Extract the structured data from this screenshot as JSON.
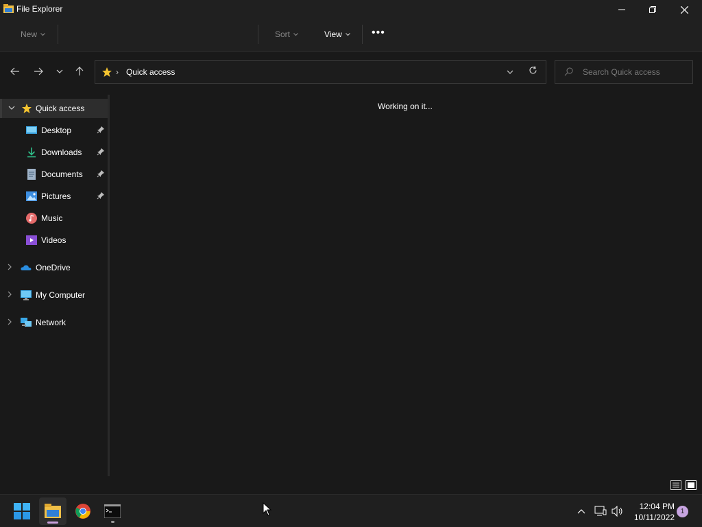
{
  "window": {
    "title": "File Explorer",
    "icon": "file-explorer-icon",
    "controls": [
      "minimize",
      "restore",
      "close"
    ]
  },
  "commandbar": {
    "new_label": "New",
    "sort_label": "Sort",
    "view_label": "View",
    "more_label": "•••"
  },
  "address": {
    "location": "Quick access",
    "location_icon": "star-icon"
  },
  "search": {
    "placeholder": "Search Quick access"
  },
  "navpane": {
    "quick_access": {
      "label": "Quick access",
      "expanded": true,
      "items": [
        {
          "label": "Desktop",
          "icon": "desktop-icon",
          "pinned": true
        },
        {
          "label": "Downloads",
          "icon": "download-icon",
          "pinned": true
        },
        {
          "label": "Documents",
          "icon": "document-icon",
          "pinned": true
        },
        {
          "label": "Pictures",
          "icon": "pictures-icon",
          "pinned": true
        },
        {
          "label": "Music",
          "icon": "music-icon",
          "pinned": false
        },
        {
          "label": "Videos",
          "icon": "videos-icon",
          "pinned": false
        }
      ]
    },
    "onedrive": {
      "label": "OneDrive",
      "icon": "cloud-icon"
    },
    "my_computer": {
      "label": "My Computer",
      "icon": "computer-icon"
    },
    "network": {
      "label": "Network",
      "icon": "network-icon"
    }
  },
  "content": {
    "status": "Working on it..."
  },
  "taskbar": {
    "apps": [
      "start",
      "file-explorer",
      "chrome",
      "terminal"
    ],
    "clock_time": "12:04 PM",
    "clock_date": "10/11/2022",
    "notification_count": "1"
  },
  "colors": {
    "window_bg": "#191919",
    "chrome_bg": "#202020",
    "accent_star": "#f4c430",
    "taskbar_bg": "#1f1f1f"
  }
}
